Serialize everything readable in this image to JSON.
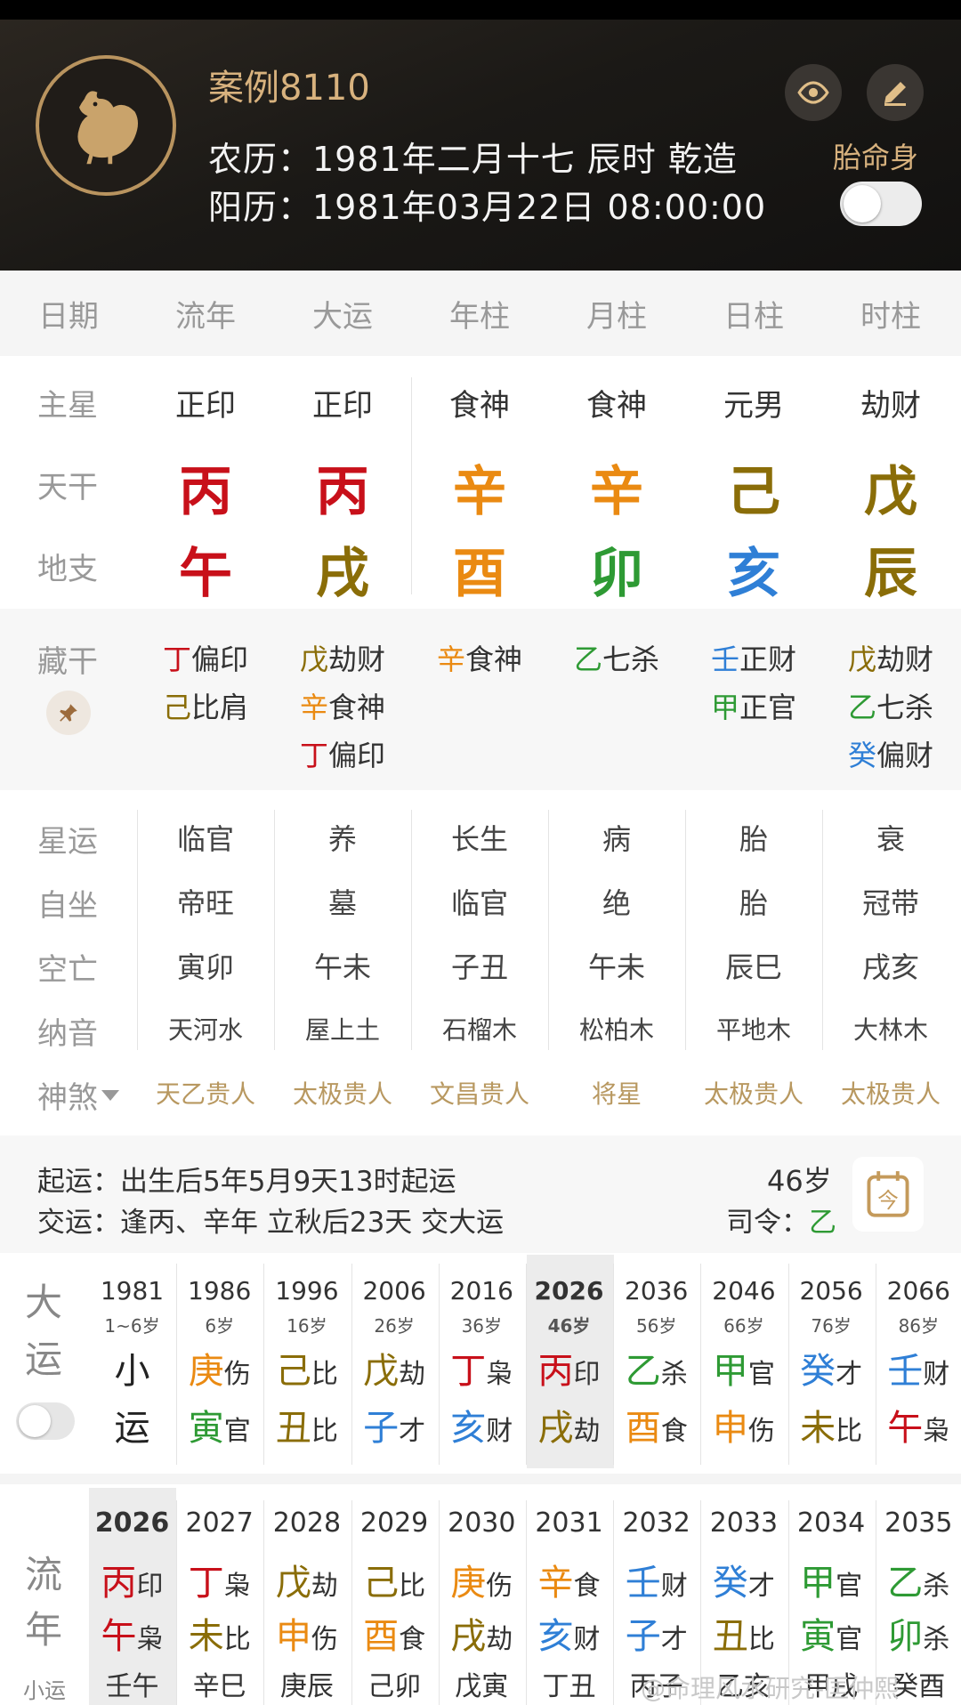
{
  "header": {
    "title": "案例8110",
    "lunar": "农历：1981年二月十七 辰时 乾造",
    "solar": "阳历：1981年03月22日 08:00:00",
    "taiming_label": "胎命身"
  },
  "columns": [
    "日期",
    "流年",
    "大运",
    "年柱",
    "月柱",
    "日柱",
    "时柱"
  ],
  "labels": {
    "zhuxing": "主星",
    "tiangan": "天干",
    "dizhi": "地支",
    "canggan": "藏干",
    "xingyun": "星运",
    "zizuo": "自坐",
    "kongwang": "空亡",
    "nayin": "纳音",
    "shensha": "神煞"
  },
  "zhuxing": [
    "正印",
    "正印",
    "食神",
    "食神",
    "元男",
    "劫财"
  ],
  "tiangan": [
    {
      "c": "丙",
      "color": "#c8101a"
    },
    {
      "c": "丙",
      "color": "#c8101a"
    },
    {
      "c": "辛",
      "color": "#ea8a12"
    },
    {
      "c": "辛",
      "color": "#ea8a12"
    },
    {
      "c": "己",
      "color": "#8a6d08"
    },
    {
      "c": "戊",
      "color": "#8a6d08"
    }
  ],
  "dizhi": [
    {
      "c": "午",
      "color": "#c8101a"
    },
    {
      "c": "戌",
      "color": "#8a6d08"
    },
    {
      "c": "酉",
      "color": "#ea8a12"
    },
    {
      "c": "卯",
      "color": "#2e9a34"
    },
    {
      "c": "亥",
      "color": "#2f7fd6"
    },
    {
      "c": "辰",
      "color": "#8a6d08"
    }
  ],
  "canggan": [
    [
      {
        "g": "丁",
        "color": "#c8101a",
        "s": "偏印"
      },
      {
        "g": "己",
        "color": "#8a6d08",
        "s": "比肩"
      }
    ],
    [
      {
        "g": "戊",
        "color": "#8a6d08",
        "s": "劫财"
      },
      {
        "g": "辛",
        "color": "#ea8a12",
        "s": "食神"
      },
      {
        "g": "丁",
        "color": "#c8101a",
        "s": "偏印"
      }
    ],
    [
      {
        "g": "辛",
        "color": "#ea8a12",
        "s": "食神"
      }
    ],
    [
      {
        "g": "乙",
        "color": "#2e9a34",
        "s": "七杀"
      }
    ],
    [
      {
        "g": "壬",
        "color": "#2f7fd6",
        "s": "正财"
      },
      {
        "g": "甲",
        "color": "#2e9a34",
        "s": "正官"
      }
    ],
    [
      {
        "g": "戊",
        "color": "#8a6d08",
        "s": "劫财"
      },
      {
        "g": "乙",
        "color": "#2e9a34",
        "s": "七杀"
      },
      {
        "g": "癸",
        "color": "#2f7fd6",
        "s": "偏财"
      }
    ]
  ],
  "xingyun": [
    "临官",
    "养",
    "长生",
    "病",
    "胎",
    "衰"
  ],
  "zizuo": [
    "帝旺",
    "墓",
    "临官",
    "绝",
    "胎",
    "冠带"
  ],
  "kongwang": [
    "寅卯",
    "午未",
    "子丑",
    "午未",
    "辰巳",
    "戌亥"
  ],
  "nayin": [
    "天河水",
    "屋上土",
    "石榴木",
    "松柏木",
    "平地木",
    "大林木"
  ],
  "shensha": [
    "天乙贵人",
    "太极贵人",
    "文昌贵人",
    "将星",
    "太极贵人",
    "太极贵人"
  ],
  "qiyun": {
    "line1": "起运：出生后5年5月9天13时起运",
    "line2": "交运：逢丙、辛年 立秋后23天 交大运",
    "age": "46岁",
    "siling_label": "司令：",
    "siling_value": "乙",
    "siling_color": "#2e9a34"
  },
  "dayun": {
    "label_a": "大",
    "label_b": "运",
    "items": [
      {
        "year": "1981",
        "age": "1~6岁",
        "g": "小",
        "gc": "#222",
        "gs": "",
        "z": "运",
        "zc": "#222",
        "zs": ""
      },
      {
        "year": "1986",
        "age": "6岁",
        "g": "庚",
        "gc": "#ea8a12",
        "gs": "伤",
        "z": "寅",
        "zc": "#2e9a34",
        "zs": "官"
      },
      {
        "year": "1996",
        "age": "16岁",
        "g": "己",
        "gc": "#8a6d08",
        "gs": "比",
        "z": "丑",
        "zc": "#8a6d08",
        "zs": "比"
      },
      {
        "year": "2006",
        "age": "26岁",
        "g": "戊",
        "gc": "#8a6d08",
        "gs": "劫",
        "z": "子",
        "zc": "#2f7fd6",
        "zs": "才"
      },
      {
        "year": "2016",
        "age": "36岁",
        "g": "丁",
        "gc": "#c8101a",
        "gs": "枭",
        "z": "亥",
        "zc": "#2f7fd6",
        "zs": "财"
      },
      {
        "year": "2026",
        "age": "46岁",
        "g": "丙",
        "gc": "#c8101a",
        "gs": "印",
        "z": "戌",
        "zc": "#8a6d08",
        "zs": "劫"
      },
      {
        "year": "2036",
        "age": "56岁",
        "g": "乙",
        "gc": "#2e9a34",
        "gs": "杀",
        "z": "酉",
        "zc": "#ea8a12",
        "zs": "食"
      },
      {
        "year": "2046",
        "age": "66岁",
        "g": "甲",
        "gc": "#2e9a34",
        "gs": "官",
        "z": "申",
        "zc": "#ea8a12",
        "zs": "伤"
      },
      {
        "year": "2056",
        "age": "76岁",
        "g": "癸",
        "gc": "#2f7fd6",
        "gs": "才",
        "z": "未",
        "zc": "#8a6d08",
        "zs": "比"
      },
      {
        "year": "2066",
        "age": "86岁",
        "g": "壬",
        "gc": "#2f7fd6",
        "gs": "财",
        "z": "午",
        "zc": "#c8101a",
        "zs": "枭"
      }
    ]
  },
  "liunian": {
    "label_a": "流",
    "label_b": "年",
    "label_c": "小运",
    "items": [
      {
        "year": "2026",
        "g": "丙",
        "gc": "#c8101a",
        "gs": "印",
        "z": "午",
        "zc": "#c8101a",
        "zs": "枭",
        "x": "壬午"
      },
      {
        "year": "2027",
        "g": "丁",
        "gc": "#c8101a",
        "gs": "枭",
        "z": "未",
        "zc": "#8a6d08",
        "zs": "比",
        "x": "辛巳"
      },
      {
        "year": "2028",
        "g": "戊",
        "gc": "#8a6d08",
        "gs": "劫",
        "z": "申",
        "zc": "#ea8a12",
        "zs": "伤",
        "x": "庚辰"
      },
      {
        "year": "2029",
        "g": "己",
        "gc": "#8a6d08",
        "gs": "比",
        "z": "酉",
        "zc": "#ea8a12",
        "zs": "食",
        "x": "己卯"
      },
      {
        "year": "2030",
        "g": "庚",
        "gc": "#ea8a12",
        "gs": "伤",
        "z": "戌",
        "zc": "#8a6d08",
        "zs": "劫",
        "x": "戊寅"
      },
      {
        "year": "2031",
        "g": "辛",
        "gc": "#ea8a12",
        "gs": "食",
        "z": "亥",
        "zc": "#2f7fd6",
        "zs": "财",
        "x": "丁丑"
      },
      {
        "year": "2032",
        "g": "壬",
        "gc": "#2f7fd6",
        "gs": "财",
        "z": "子",
        "zc": "#2f7fd6",
        "zs": "才",
        "x": "丙子"
      },
      {
        "year": "2033",
        "g": "癸",
        "gc": "#2f7fd6",
        "gs": "才",
        "z": "丑",
        "zc": "#8a6d08",
        "zs": "比",
        "x": "乙亥"
      },
      {
        "year": "2034",
        "g": "甲",
        "gc": "#2e9a34",
        "gs": "官",
        "z": "寅",
        "zc": "#2e9a34",
        "zs": "官",
        "x": "甲戌"
      },
      {
        "year": "2035",
        "g": "乙",
        "gc": "#2e9a34",
        "gs": "杀",
        "z": "卯",
        "zc": "#2e9a34",
        "zs": "杀",
        "x": "癸酉"
      }
    ]
  },
  "watermark": "@命理风水研究-匡仲熙"
}
